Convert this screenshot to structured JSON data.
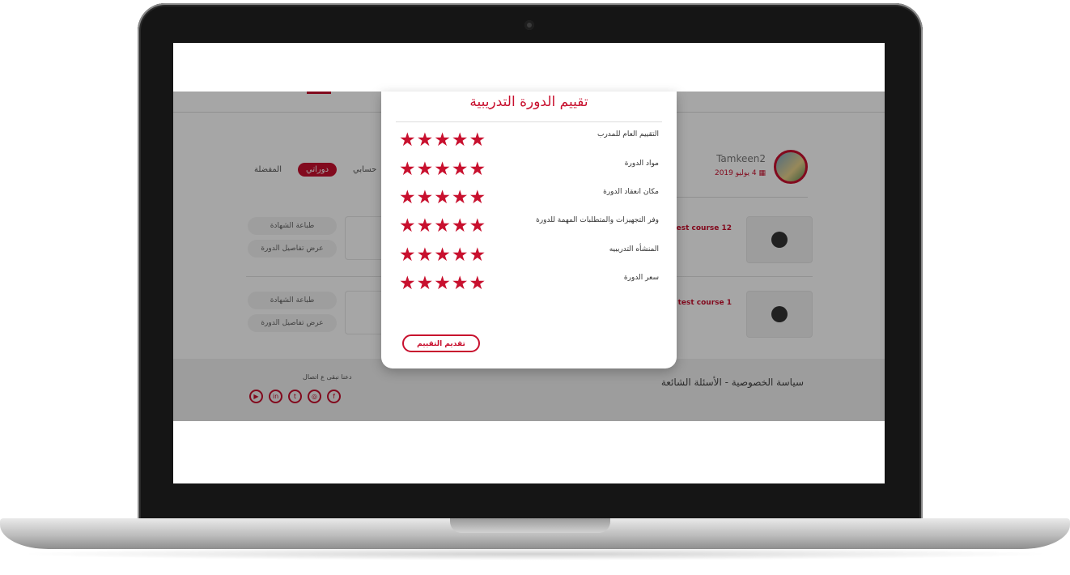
{
  "modal": {
    "title": "تقييم الدورة التدريبية",
    "criteria": [
      {
        "label": "التقييم العام للمدرب",
        "stars": 5
      },
      {
        "label": "مواد الدورة",
        "stars": 5
      },
      {
        "label": "مكان انعقاد الدورة",
        "stars": 5
      },
      {
        "label": "وفر التجهيزات والمتطلبات المهمة للدورة",
        "stars": 5
      },
      {
        "label": "المنشأه التدريبيه",
        "stars": 5
      },
      {
        "label": "سعر الدورة",
        "stars": 5
      }
    ],
    "submit_label": "تقديم التقييم"
  },
  "profile": {
    "name": "Tamkeen2",
    "date": "4 يوليو 2019"
  },
  "tabs": [
    {
      "label": "حسابي",
      "active": false
    },
    {
      "label": "دوراتي",
      "active": true
    },
    {
      "label": "المفضلة",
      "active": false
    }
  ],
  "courses": [
    {
      "title": "en test course 12",
      "print_label": "طباعة الشهادة",
      "details_label": "عرض تفاصيل الدورة"
    },
    {
      "title": "een test course 1",
      "print_label": "طباعة الشهادة",
      "details_label": "عرض تفاصيل الدورة"
    }
  ],
  "footer": {
    "links": "سياسة الخصوصية - الأسئلة الشائعة",
    "social_title": "دعنا نبقى ع اتصال"
  },
  "icons": {
    "star": "star-icon",
    "calendar": "calendar-icon",
    "social": [
      "youtube-icon",
      "linkedin-icon",
      "twitter-icon",
      "instagram-icon",
      "facebook-icon"
    ]
  },
  "colors": {
    "accent": "#c8102e"
  }
}
